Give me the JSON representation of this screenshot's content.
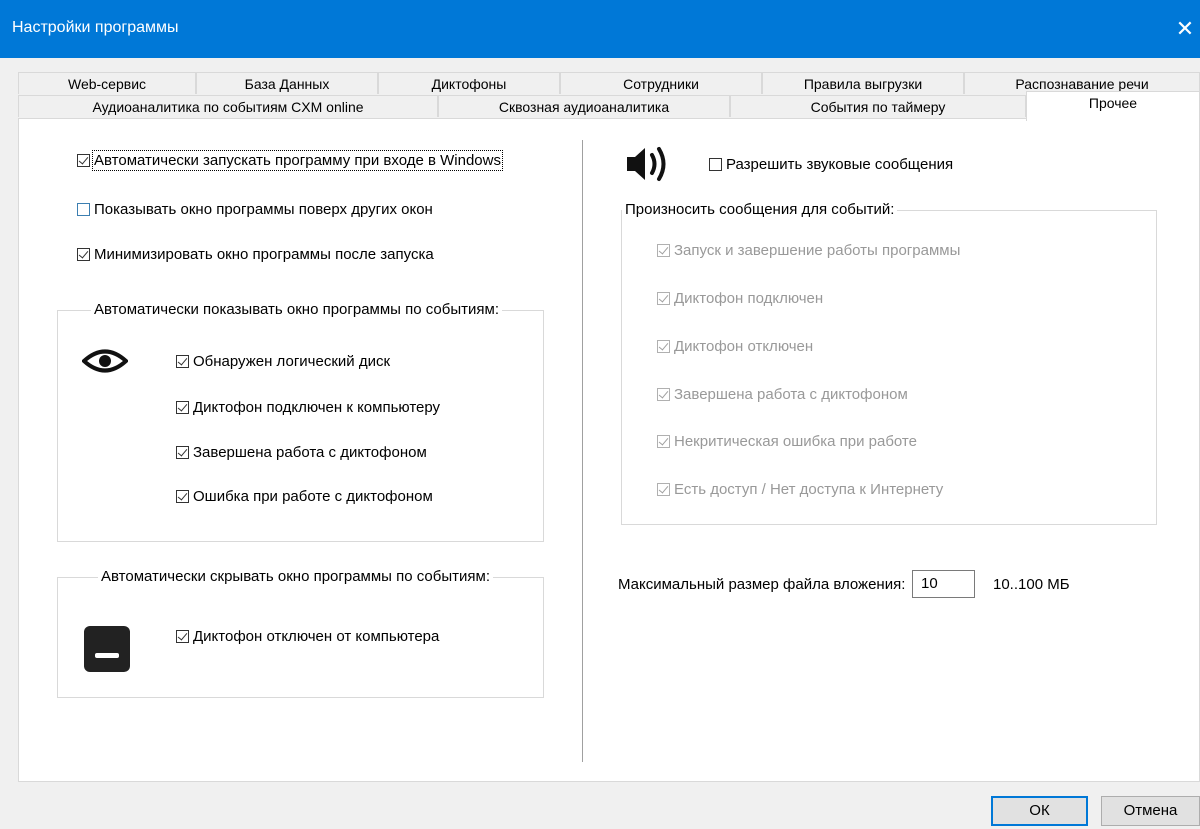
{
  "window": {
    "title": "Настройки программы",
    "close_glyph": "✕"
  },
  "tabs_row1": [
    "Web-сервис",
    "База Данных",
    "Диктофоны",
    "Сотрудники",
    "Правила выгрузки",
    "Распознавание речи"
  ],
  "tabs_row2": [
    "Аудиоаналитика по событиям CXM online",
    "Сквозная аудиоаналитика",
    "События по таймеру",
    "Прочее"
  ],
  "active_tab": "Прочее",
  "left": {
    "autostart": {
      "label": "Автоматически запускать программу при входе в Windows",
      "checked": true
    },
    "on_top": {
      "label": "Показывать окно программы поверх других окон",
      "checked": false
    },
    "minimize": {
      "label": "Минимизировать окно программы после запуска",
      "checked": true
    },
    "show_group": {
      "title": "Автоматически показывать окно программы по событиям:",
      "icon": "eye-icon",
      "items": [
        {
          "label": "Обнаружен логический диск",
          "checked": true
        },
        {
          "label": "Диктофон подключен к компьютеру",
          "checked": true
        },
        {
          "label": "Завершена работа с диктофоном",
          "checked": true
        },
        {
          "label": "Ошибка при работе с диктофоном",
          "checked": true
        }
      ]
    },
    "hide_group": {
      "title": "Автоматически скрывать окно программы по событиям:",
      "icon": "minimize-icon",
      "items": [
        {
          "label": "Диктофон отключен от компьютера",
          "checked": true
        }
      ]
    }
  },
  "right": {
    "sound_icon": "speaker-icon",
    "sound_enable": {
      "label": "Разрешить звуковые сообщения",
      "checked": false
    },
    "speak_group": {
      "title": "Произносить сообщения для событий:",
      "items": [
        {
          "label": "Запуск и завершение работы программы",
          "checked": true
        },
        {
          "label": "Диктофон подключен",
          "checked": true
        },
        {
          "label": "Диктофон отключен",
          "checked": true
        },
        {
          "label": "Завершена работа с диктофоном",
          "checked": true
        },
        {
          "label": "Некритическая ошибка при работе",
          "checked": true
        },
        {
          "label": "Есть доступ / Нет доступа к Интернету",
          "checked": true
        }
      ]
    },
    "max_size": {
      "label": "Максимальный размер файла вложения:",
      "value": "10",
      "range": "10..100 МБ"
    }
  },
  "buttons": {
    "ok": "ОК",
    "cancel": "Отмена"
  }
}
